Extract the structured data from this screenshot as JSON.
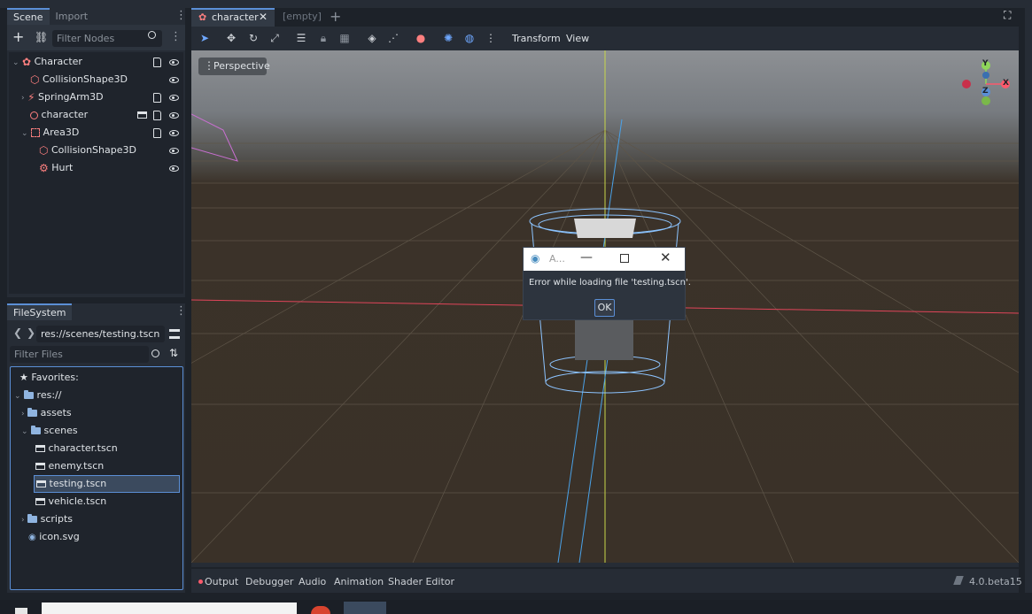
{
  "scene_dock": {
    "tabs": [
      "Scene",
      "Import"
    ],
    "filter_placeholder": "Filter Nodes",
    "nodes": [
      {
        "label": "Character"
      },
      {
        "label": "CollisionShape3D"
      },
      {
        "label": "SpringArm3D"
      },
      {
        "label": "character"
      },
      {
        "label": "Area3D"
      },
      {
        "label": "CollisionShape3D"
      },
      {
        "label": "Hurt"
      }
    ]
  },
  "filesystem_dock": {
    "tab": "FileSystem",
    "path": "res://scenes/testing.tscn",
    "filter_placeholder": "Filter Files",
    "items": [
      {
        "label": "Favorites:"
      },
      {
        "label": "res://"
      },
      {
        "label": "assets"
      },
      {
        "label": "scenes"
      },
      {
        "label": "character.tscn"
      },
      {
        "label": "enemy.tscn"
      },
      {
        "label": "testing.tscn"
      },
      {
        "label": "vehicle.tscn"
      },
      {
        "label": "scripts"
      },
      {
        "label": "icon.svg"
      }
    ]
  },
  "editor_tabs": {
    "tabs": [
      "character",
      "[empty]"
    ]
  },
  "toolbar": {
    "transform_label": "Transform",
    "view_label": "View"
  },
  "viewport": {
    "perspective_label": "Perspective",
    "gizmo": {
      "y": "Y",
      "z": "Z",
      "x": "X"
    }
  },
  "dialog": {
    "title": "A...",
    "message": "Error while loading file 'testing.tscn'.",
    "ok_label": "OK"
  },
  "bottom_panel": {
    "tabs": [
      "Output",
      "Debugger",
      "Audio",
      "Animation",
      "Shader Editor"
    ],
    "version": "4.0.beta15"
  },
  "colors": {
    "accent": "#5b8fd6",
    "node_red": "#fc7f7f",
    "panel": "#262c35",
    "ground": "#3a3128"
  }
}
